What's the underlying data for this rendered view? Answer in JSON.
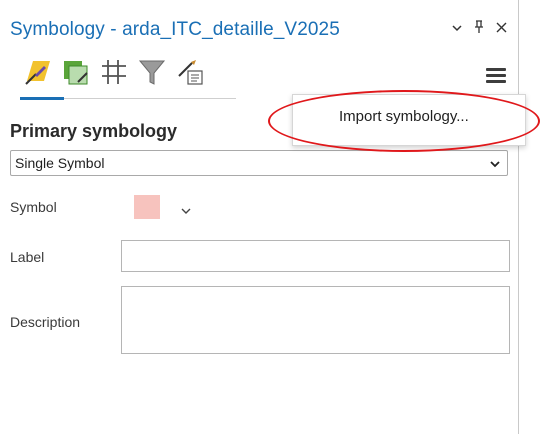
{
  "pane": {
    "title": "Symbology - arda_ITC_detaille_V2025",
    "title_color": "#1a6fb5",
    "controls": [
      {
        "name": "options",
        "glyph": "⌄"
      },
      {
        "name": "auto-hide-pin",
        "glyph": "ᛘ"
      },
      {
        "name": "close",
        "glyph": "×"
      }
    ]
  },
  "toolbar": {
    "tabs": [
      {
        "icon": "primary-symbology-icon",
        "active": true
      },
      {
        "icon": "vary-symbology-icon",
        "active": false
      },
      {
        "icon": "symbol-layer-drawing-icon",
        "active": false
      },
      {
        "icon": "filter-icon",
        "active": false
      },
      {
        "icon": "label-class-icon",
        "active": false
      }
    ],
    "menu_icon": "hamburger-menu-icon"
  },
  "menu": {
    "items": [
      {
        "label": "Import symbology..."
      }
    ],
    "highlight_color": "#e0181b"
  },
  "primary": {
    "heading": "Primary symbology",
    "type_value": "Single Symbol",
    "symbol_label": "Symbol",
    "symbol_color": "#f7c3be",
    "label_label": "Label",
    "label_value": "",
    "description_label": "Description",
    "description_value": ""
  }
}
